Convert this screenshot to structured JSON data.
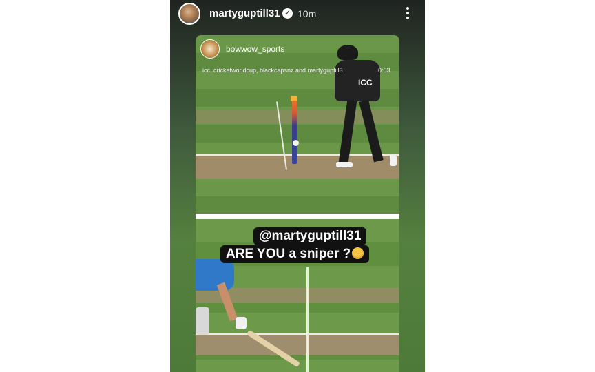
{
  "story": {
    "username": "martyguptill31",
    "time": "10m",
    "verified_icon": "verified-badge-icon",
    "more_icon": "more-dots-icon"
  },
  "repost": {
    "account": "bowwow_sports",
    "tags": "icc, cricketworldcup, blackcapsnz and martyguptill3",
    "timestamp": "0:03",
    "player_logo": "ICC"
  },
  "caption": {
    "line1": "@martyguptill31",
    "line2": "ARE YOU a sniper ?"
  }
}
